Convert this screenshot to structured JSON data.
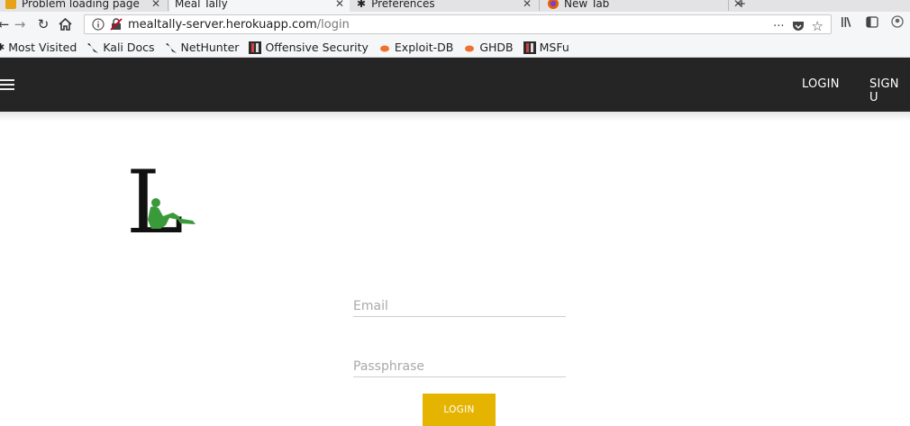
{
  "browser": {
    "tabs": [
      {
        "title": "Problem loading page",
        "active": false
      },
      {
        "title": "Meal Tally",
        "active": true
      },
      {
        "title": "Preferences",
        "active": false
      },
      {
        "title": "New Tab",
        "active": false
      }
    ],
    "url": {
      "host": "mealtally-server.herokuapp.com",
      "path": "/login",
      "page_actions": "···"
    },
    "bookmarks": [
      {
        "label": "Most Visited",
        "icon": "star-icon"
      },
      {
        "label": "Kali Docs",
        "icon": "kali-dragon-icon"
      },
      {
        "label": "NetHunter",
        "icon": "kali-dragon-icon"
      },
      {
        "label": "Offensive Security",
        "icon": "offsec-icon"
      },
      {
        "label": "Exploit-DB",
        "icon": "bug-icon"
      },
      {
        "label": "GHDB",
        "icon": "bug-icon"
      },
      {
        "label": "MSFu",
        "icon": "offsec-icon"
      }
    ]
  },
  "app": {
    "header": {
      "login_label": "LOGIN",
      "signup_label": "SIGN U",
      "background": "#252525"
    },
    "form": {
      "email_placeholder": "Email",
      "passphrase_placeholder": "Passphrase",
      "submit_label": "LOGIN",
      "submit_color": "#e5b400"
    },
    "logo": {
      "letter": "L",
      "figure_color": "#3a9a3a"
    }
  }
}
